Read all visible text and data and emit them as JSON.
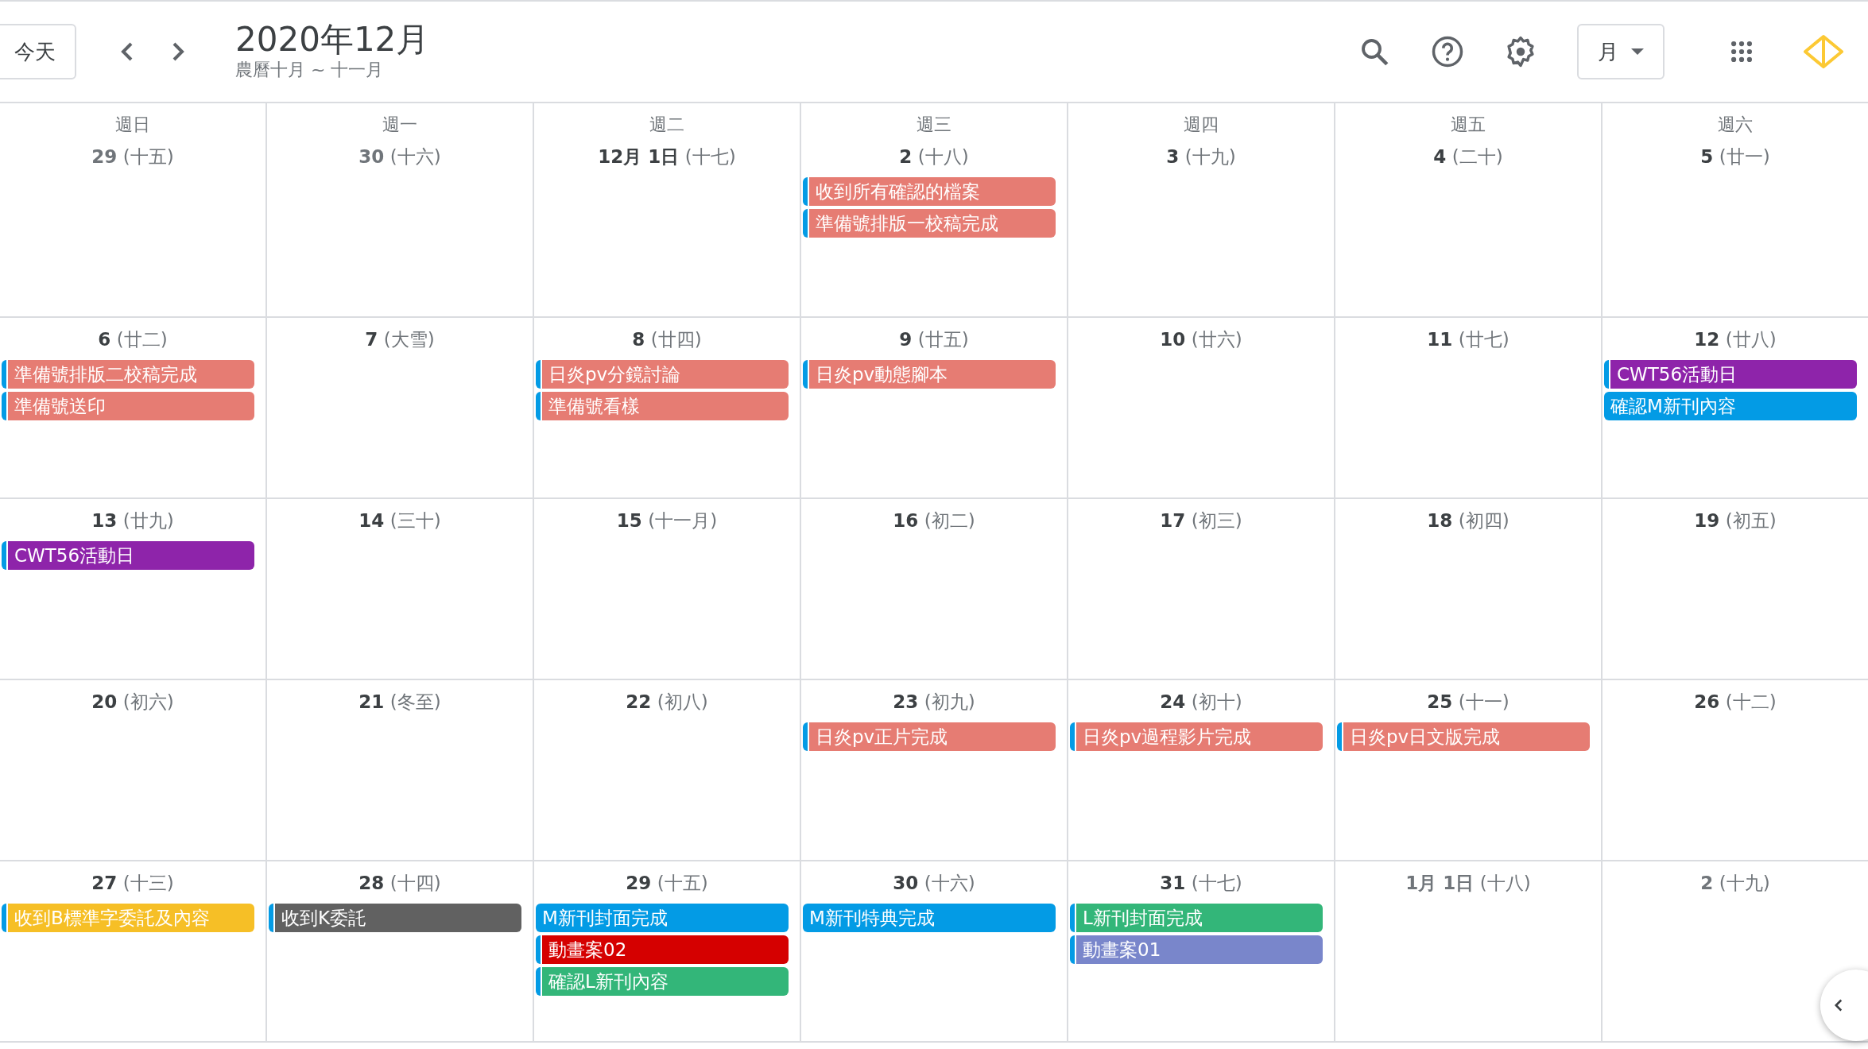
{
  "toolbar": {
    "today_button": "今天",
    "title": "2020年12月",
    "subtitle": "農曆十月 ~ 十一月",
    "view_select": "月"
  },
  "weekdays": [
    "週日",
    "週一",
    "週二",
    "週三",
    "週四",
    "週五",
    "週六"
  ],
  "weeks": [
    {
      "days": [
        {
          "date": "29",
          "lunar": "(十五)",
          "other_month": true
        },
        {
          "date": "30",
          "lunar": "(十六)",
          "other_month": true
        },
        {
          "date": "12月 1日",
          "lunar": "(十七)",
          "other_month": false
        },
        {
          "date": "2",
          "lunar": "(十八)",
          "other_month": false,
          "events": [
            {
              "title": "收到所有確認的檔案",
              "color": "#e67c73",
              "stripe": true
            },
            {
              "title": "準備號排版一校稿完成",
              "color": "#e67c73",
              "stripe": true
            }
          ]
        },
        {
          "date": "3",
          "lunar": "(十九)",
          "other_month": false
        },
        {
          "date": "4",
          "lunar": "(二十)",
          "other_month": false
        },
        {
          "date": "5",
          "lunar": "(廿一)",
          "other_month": false
        }
      ]
    },
    {
      "days": [
        {
          "date": "6",
          "lunar": "(廿二)",
          "other_month": false,
          "events": [
            {
              "title": "準備號排版二校稿完成",
              "color": "#e67c73",
              "stripe": true
            },
            {
              "title": "準備號送印",
              "color": "#e67c73",
              "stripe": true
            }
          ]
        },
        {
          "date": "7",
          "lunar": "(大雪)",
          "other_month": false
        },
        {
          "date": "8",
          "lunar": "(廿四)",
          "other_month": false,
          "events": [
            {
              "title": "日炎pv分鏡討論",
              "color": "#e67c73",
              "stripe": true
            },
            {
              "title": "準備號看樣",
              "color": "#e67c73",
              "stripe": true
            }
          ]
        },
        {
          "date": "9",
          "lunar": "(廿五)",
          "other_month": false,
          "events": [
            {
              "title": "日炎pv動態腳本",
              "color": "#e67c73",
              "stripe": true
            }
          ]
        },
        {
          "date": "10",
          "lunar": "(廿六)",
          "other_month": false
        },
        {
          "date": "11",
          "lunar": "(廿七)",
          "other_month": false
        },
        {
          "date": "12",
          "lunar": "(廿八)",
          "other_month": false,
          "events": [
            {
              "title": "CWT56活動日",
              "color": "#8e24aa",
              "stripe": true
            },
            {
              "title": "確認M新刊內容",
              "color": "#039be5",
              "stripe": false
            }
          ]
        }
      ]
    },
    {
      "days": [
        {
          "date": "13",
          "lunar": "(廿九)",
          "other_month": false,
          "events": [
            {
              "title": "CWT56活動日",
              "color": "#8e24aa",
              "stripe": true
            }
          ]
        },
        {
          "date": "14",
          "lunar": "(三十)",
          "other_month": false
        },
        {
          "date": "15",
          "lunar": "(十一月)",
          "other_month": false
        },
        {
          "date": "16",
          "lunar": "(初二)",
          "other_month": false
        },
        {
          "date": "17",
          "lunar": "(初三)",
          "other_month": false
        },
        {
          "date": "18",
          "lunar": "(初四)",
          "other_month": false
        },
        {
          "date": "19",
          "lunar": "(初五)",
          "other_month": false
        }
      ]
    },
    {
      "days": [
        {
          "date": "20",
          "lunar": "(初六)",
          "other_month": false
        },
        {
          "date": "21",
          "lunar": "(冬至)",
          "other_month": false
        },
        {
          "date": "22",
          "lunar": "(初八)",
          "other_month": false
        },
        {
          "date": "23",
          "lunar": "(初九)",
          "other_month": false,
          "events": [
            {
              "title": "日炎pv正片完成",
              "color": "#e67c73",
              "stripe": true
            }
          ]
        },
        {
          "date": "24",
          "lunar": "(初十)",
          "other_month": false,
          "events": [
            {
              "title": "日炎pv過程影片完成",
              "color": "#e67c73",
              "stripe": true
            }
          ]
        },
        {
          "date": "25",
          "lunar": "(十一)",
          "other_month": false,
          "events": [
            {
              "title": "日炎pv日文版完成",
              "color": "#e67c73",
              "stripe": true
            }
          ]
        },
        {
          "date": "26",
          "lunar": "(十二)",
          "other_month": false
        }
      ]
    },
    {
      "days": [
        {
          "date": "27",
          "lunar": "(十三)",
          "other_month": false,
          "events": [
            {
              "title": "收到B標準字委託及內容",
              "color": "#f6bf26",
              "stripe": true
            }
          ]
        },
        {
          "date": "28",
          "lunar": "(十四)",
          "other_month": false,
          "events": [
            {
              "title": "收到K委託",
              "color": "#616161",
              "stripe": true
            }
          ]
        },
        {
          "date": "29",
          "lunar": "(十五)",
          "other_month": false,
          "events": [
            {
              "title": "M新刊封面完成",
              "color": "#039be5",
              "stripe": false
            },
            {
              "title": "動畫案02",
              "color": "#d50000",
              "stripe": true
            },
            {
              "title": "確認L新刊內容",
              "color": "#33b679",
              "stripe": true
            }
          ]
        },
        {
          "date": "30",
          "lunar": "(十六)",
          "other_month": false,
          "events": [
            {
              "title": "M新刊特典完成",
              "color": "#039be5",
              "stripe": false
            }
          ]
        },
        {
          "date": "31",
          "lunar": "(十七)",
          "other_month": false,
          "events": [
            {
              "title": "L新刊封面完成",
              "color": "#33b679",
              "stripe": true
            },
            {
              "title": "動畫案01",
              "color": "#7986cb",
              "stripe": true
            }
          ]
        },
        {
          "date": "1月 1日",
          "lunar": "(十八)",
          "other_month": true
        },
        {
          "date": "2",
          "lunar": "(十九)",
          "other_month": true
        }
      ]
    }
  ]
}
